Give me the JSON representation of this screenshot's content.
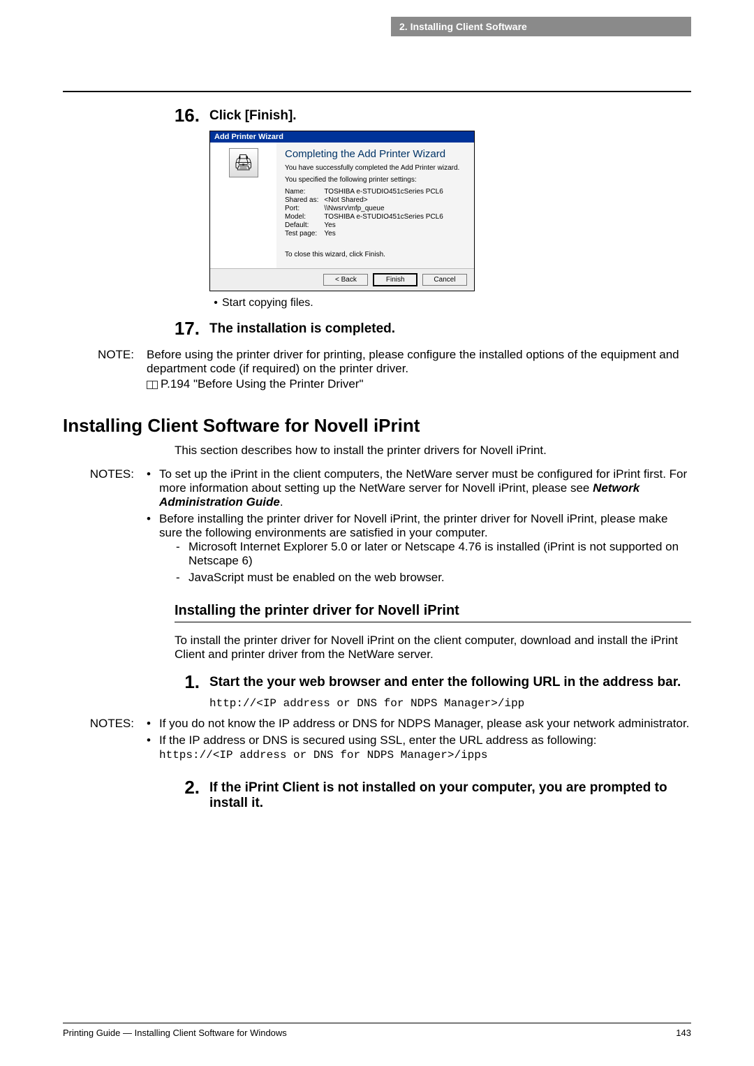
{
  "header": {
    "chapter": "2. Installing Client Software"
  },
  "step16": {
    "num": "16.",
    "title": "Click [Finish].",
    "dialog": {
      "title": "Add Printer Wizard",
      "heading": "Completing the Add Printer Wizard",
      "line1": "You have successfully completed the Add Printer wizard.",
      "line2": "You specified the following printer settings:",
      "props": {
        "nameLabel": "Name:",
        "name": "TOSHIBA e-STUDIO451cSeries PCL6",
        "sharedLabel": "Shared as:",
        "shared": "<Not Shared>",
        "portLabel": "Port:",
        "port": "\\\\Nwsrv\\mfp_queue",
        "modelLabel": "Model:",
        "model": "TOSHIBA e-STUDIO451cSeries PCL6",
        "defaultLabel": "Default:",
        "default": "Yes",
        "testLabel": "Test page:",
        "test": "Yes"
      },
      "closeLine": "To close this wizard, click Finish.",
      "btnBack": "< Back",
      "btnFinish": "Finish",
      "btnCancel": "Cancel"
    },
    "bullet": "Start copying files."
  },
  "step17": {
    "num": "17.",
    "title": "The installation is completed."
  },
  "note1": {
    "label": "NOTE:",
    "l1": "Before using the printer driver for printing, please configure the installed options of the equipment and department code (if required) on the printer driver.",
    "l2": "P.194 \"Before Using the Printer Driver\""
  },
  "section": {
    "title": "Installing Client Software for Novell iPrint",
    "intro": "This section describes how to install the printer drivers for Novell iPrint."
  },
  "notes2": {
    "label": "NOTES:",
    "i1a": "To set up the iPrint in the client computers, the NetWare server must be configured for iPrint first.  For more information about setting up the NetWare server for Novell iPrint, please see ",
    "i1b": "Network Administration Guide",
    "i1c": ".",
    "i2": "Before installing the printer driver for Novell iPrint, the printer driver for Novell iPrint, please make sure the following environments are satisfied in your computer.",
    "s1": "Microsoft Internet Explorer 5.0 or later or Netscape 4.76 is installed (iPrint is not supported on Netscape 6)",
    "s2": "JavaScript must be enabled on the web browser."
  },
  "subhead": "Installing the printer driver for Novell iPrint",
  "para1": "To install the printer driver for Novell iPrint on the client computer, download and install the iPrint Client and printer driver from the NetWare server.",
  "step1": {
    "num": "1.",
    "title": "Start the your web browser and enter the following URL in the address bar.",
    "code": "http://<IP address or DNS for NDPS Manager>/ipp"
  },
  "notes3": {
    "label": "NOTES:",
    "i1": "If you do not know the IP address or DNS for NDPS Manager, please ask your network administrator.",
    "i2": "If the IP address or DNS is secured using SSL, enter the URL address as following:",
    "code": "https://<IP address or DNS for NDPS Manager>/ipps"
  },
  "step2": {
    "num": "2.",
    "title": "If the iPrint Client is not installed on your computer, you are prompted to install it."
  },
  "footer": {
    "left": "Printing Guide — Installing Client Software for Windows",
    "right": "143"
  }
}
